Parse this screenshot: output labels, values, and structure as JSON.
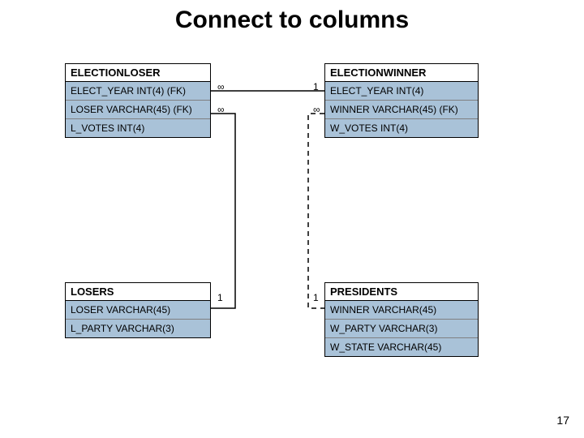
{
  "title": "Connect to columns",
  "page_number": "17",
  "cardinality": {
    "r1_left": "∞",
    "r1_right": "1",
    "r2_left_top": "∞",
    "r2_left_bottom": "1",
    "r3_right_top": "∞",
    "r3_right_bottom": "1"
  },
  "entities": {
    "electionloser": {
      "name": "ELECTIONLOSER",
      "columns": [
        "ELECT_YEAR INT(4) (FK)",
        "LOSER VARCHAR(45) (FK)",
        "L_VOTES INT(4)"
      ]
    },
    "electionwinner": {
      "name": "ELECTIONWINNER",
      "columns": [
        "ELECT_YEAR INT(4)",
        "WINNER VARCHAR(45) (FK)",
        "W_VOTES INT(4)"
      ]
    },
    "losers": {
      "name": "LOSERS",
      "columns": [
        "LOSER VARCHAR(45)",
        "L_PARTY VARCHAR(3)"
      ]
    },
    "presidents": {
      "name": "PRESIDENTS",
      "columns": [
        "WINNER VARCHAR(45)",
        "W_PARTY VARCHAR(3)",
        "W_STATE VARCHAR(45)"
      ]
    }
  }
}
